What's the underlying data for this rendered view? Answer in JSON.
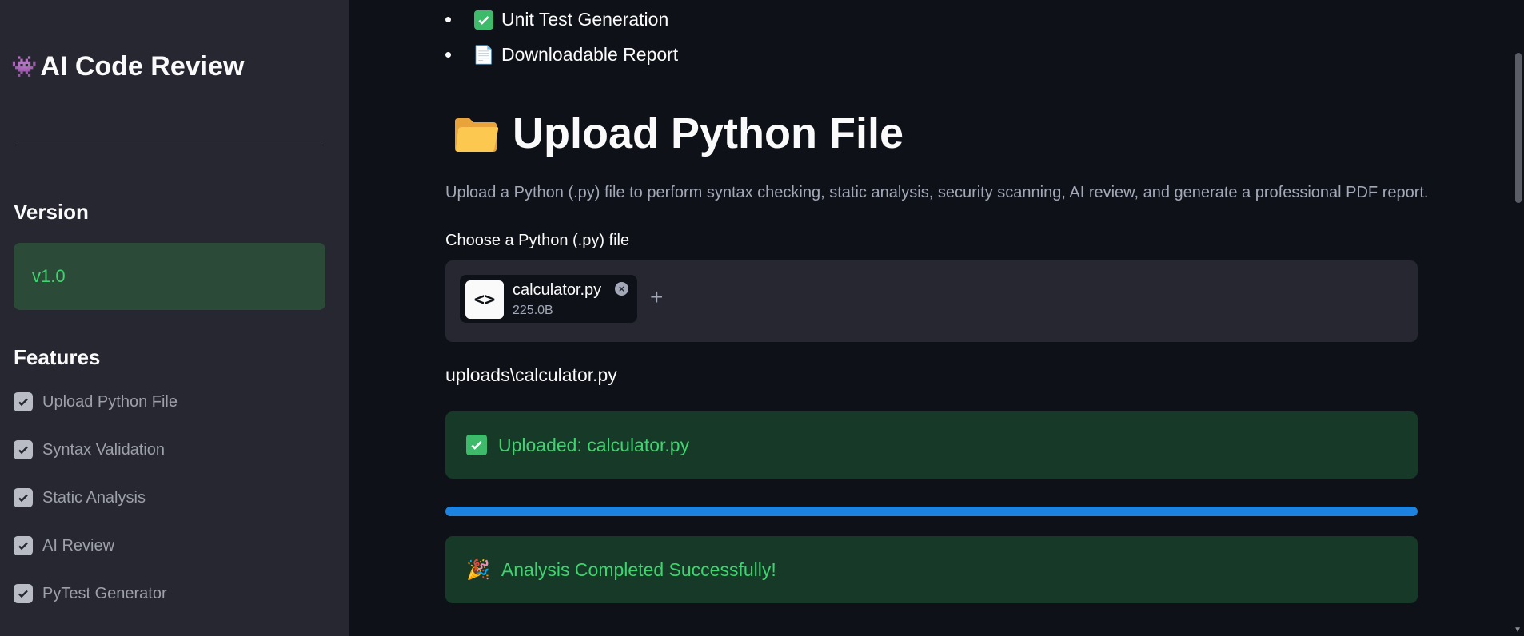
{
  "sidebar": {
    "title": "AI Code Review",
    "version_heading": "Version",
    "version_value": "v1.0",
    "features_heading": "Features",
    "features": [
      {
        "label": "Upload Python File",
        "checked": true
      },
      {
        "label": "Syntax Validation",
        "checked": true
      },
      {
        "label": "Static Analysis",
        "checked": true
      },
      {
        "label": "AI Review",
        "checked": true
      },
      {
        "label": "PyTest Generator",
        "checked": true
      }
    ]
  },
  "main": {
    "bullets": [
      {
        "icon": "check-icon",
        "text": "Unit Test Generation"
      },
      {
        "icon": "document-icon",
        "text": "Downloadable Report"
      }
    ],
    "heading": "Upload Python File",
    "heading_icon": "folder-icon",
    "description": "Upload a Python (.py) file to perform syntax checking, static analysis, security scanning, AI review, and generate a professional PDF report.",
    "uploader": {
      "label": "Choose a Python (.py) file",
      "file_icon_text": "<>",
      "file_name": "calculator.py",
      "file_size": "225.0B",
      "add_symbol": "+"
    },
    "upload_path": "uploads\\calculator.py",
    "upload_success": "Uploaded: calculator.py",
    "progress": 1.0,
    "analysis_success": "Analysis Completed Successfully!"
  },
  "colors": {
    "background": "#0e1117",
    "sidebar": "#262730",
    "success_text": "#3dd56d",
    "success_bg": "#173928",
    "progress": "#1c83e1"
  }
}
